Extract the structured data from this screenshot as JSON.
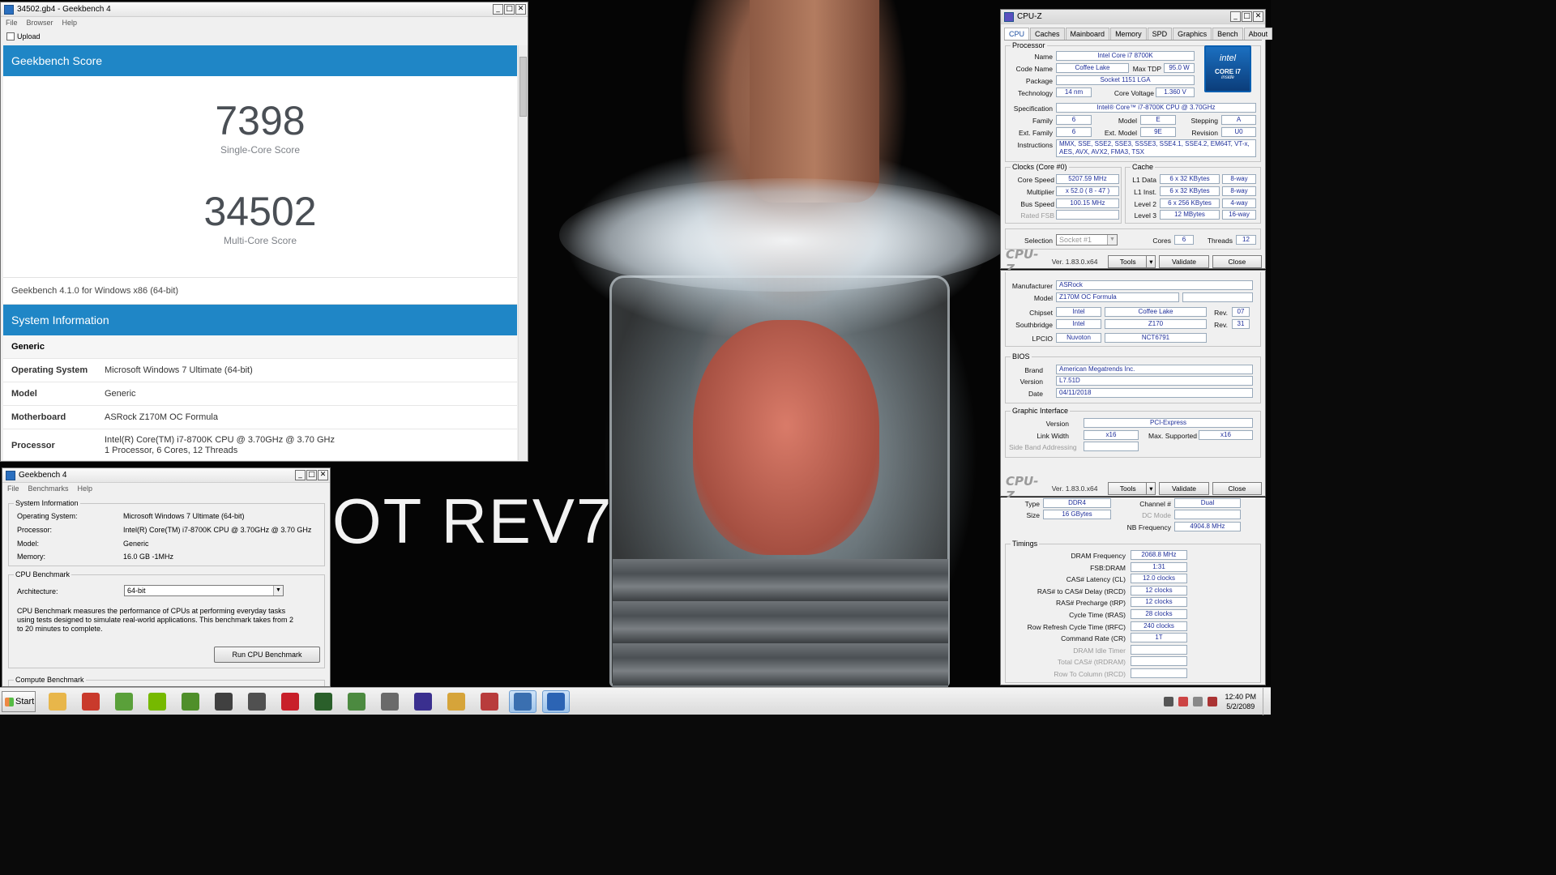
{
  "wallpaper": {
    "overlay_text": "OT REV7"
  },
  "gb_browser": {
    "title": "34502.gb4 - Geekbench 4",
    "menu": [
      "File",
      "Browser",
      "Help"
    ],
    "toolbar_upload": "Upload",
    "score_header": "Geekbench Score",
    "single_core_score": "7398",
    "single_core_label": "Single-Core Score",
    "multi_core_score": "34502",
    "multi_core_label": "Multi-Core Score",
    "version_text": "Geekbench 4.1.0 for Windows x86 (64-bit)",
    "sysinfo_header": "System Information",
    "generic_label": "Generic",
    "rows": [
      {
        "k": "Operating System",
        "v": "Microsoft Windows 7 Ultimate (64-bit)"
      },
      {
        "k": "Model",
        "v": "Generic"
      },
      {
        "k": "Motherboard",
        "v": "ASRock Z170M OC Formula"
      },
      {
        "k": "Processor",
        "v": "Intel(R) Core(TM) i7-8700K CPU @ 3.70GHz @ 3.70 GHz",
        "v2": "1 Processor, 6 Cores, 12 Threads"
      }
    ]
  },
  "gb_launcher": {
    "title": "Geekbench 4",
    "menu": [
      "File",
      "Benchmarks",
      "Help"
    ],
    "sysinfo_title": "System Information",
    "sysinfo": [
      {
        "k": "Operating System:",
        "v": "Microsoft Windows 7 Ultimate (64-bit)"
      },
      {
        "k": "Processor:",
        "v": "Intel(R) Core(TM) i7-8700K CPU @ 3.70GHz @ 3.70 GHz"
      },
      {
        "k": "Model:",
        "v": "Generic"
      },
      {
        "k": "Memory:",
        "v": "16.0 GB  -1MHz"
      }
    ],
    "cpu_bench_title": "CPU Benchmark",
    "arch_label": "Architecture:",
    "arch_value": "64-bit",
    "cpu_bench_desc": "CPU Benchmark measures the performance of CPUs at performing everyday tasks using tests designed to simulate real-world applications. This benchmark takes from 2 to 20 minutes to complete.",
    "run_button": "Run CPU Benchmark",
    "compute_title": "Compute Benchmark"
  },
  "cpuz1": {
    "title": "CPU-Z",
    "tabs": [
      "CPU",
      "Caches",
      "Mainboard",
      "Memory",
      "SPD",
      "Graphics",
      "Bench",
      "About"
    ],
    "processor_group": "Processor",
    "name_lbl": "Name",
    "name": "Intel Core i7 8700K",
    "codename_lbl": "Code Name",
    "codename": "Coffee Lake",
    "maxtdp_lbl": "Max TDP",
    "maxtdp": "95.0 W",
    "package_lbl": "Package",
    "package": "Socket 1151 LGA",
    "technology_lbl": "Technology",
    "technology": "14 nm",
    "corevolt_lbl": "Core Voltage",
    "corevolt": "1.360 V",
    "spec_lbl": "Specification",
    "spec": "Intel® Core™ i7-8700K CPU @ 3.70GHz",
    "family_lbl": "Family",
    "family": "6",
    "model_lbl": "Model",
    "model": "E",
    "stepping_lbl": "Stepping",
    "stepping": "A",
    "extfamily_lbl": "Ext. Family",
    "extfamily": "6",
    "extmodel_lbl": "Ext. Model",
    "extmodel": "9E",
    "revision_lbl": "Revision",
    "revision": "U0",
    "instr_lbl": "Instructions",
    "instr1": "MMX, SSE, SSE2, SSE3, SSSE3, SSE4.1, SSE4.2, EM64T, VT-x,",
    "instr2": "AES, AVX, AVX2, FMA3, TSX",
    "clocks_group": "Clocks (Core #0)",
    "corespeed_lbl": "Core Speed",
    "corespeed": "5207.59 MHz",
    "multiplier_lbl": "Multiplier",
    "multiplier": "x 52.0 ( 8 - 47 )",
    "busspeed_lbl": "Bus Speed",
    "busspeed": "100.15 MHz",
    "ratedfsb_lbl": "Rated FSB",
    "cache_group": "Cache",
    "l1d_lbl": "L1 Data",
    "l1d": "6 x 32 KBytes",
    "l1d_way": "8-way",
    "l1i_lbl": "L1 Inst.",
    "l1i": "6 x 32 KBytes",
    "l1i_way": "8-way",
    "l2_lbl": "Level 2",
    "l2": "6 x 256 KBytes",
    "l2_way": "4-way",
    "l3_lbl": "Level 3",
    "l3": "12 MBytes",
    "l3_way": "16-way",
    "selection_lbl": "Selection",
    "selection": "Socket #1",
    "cores_lbl": "Cores",
    "cores": "6",
    "threads_lbl": "Threads",
    "threads": "12",
    "logo": "CPU-Z",
    "version": "Ver. 1.83.0.x64",
    "tools": "Tools",
    "validate": "Validate",
    "close": "Close",
    "intel_line1": "intel",
    "intel_line2": "CORE i7",
    "intel_line3": "inside"
  },
  "cpuz2": {
    "manufacturer_lbl": "Manufacturer",
    "manufacturer": "ASRock",
    "model_lbl": "Model",
    "model": "Z170M OC Formula",
    "chipset_lbl": "Chipset",
    "chipset_vendor": "Intel",
    "chipset_name": "Coffee Lake",
    "chipset_rev_lbl": "Rev.",
    "chipset_rev": "07",
    "south_lbl": "Southbridge",
    "south_vendor": "Intel",
    "south_name": "Z170",
    "south_rev_lbl": "Rev.",
    "south_rev": "31",
    "lpcio_lbl": "LPCIO",
    "lpcio_vendor": "Nuvoton",
    "lpcio_name": "NCT6791",
    "bios_group": "BIOS",
    "brand_lbl": "Brand",
    "brand": "American Megatrends Inc.",
    "version_lbl": "Version",
    "bios_version": "L7.51D",
    "date_lbl": "Date",
    "date": "04/11/2018",
    "gi_group": "Graphic Interface",
    "gi_version_lbl": "Version",
    "gi_version": "PCI-Express",
    "linkwidth_lbl": "Link Width",
    "linkwidth": "x16",
    "maxsup_lbl": "Max. Supported",
    "maxsup": "x16",
    "sideband_lbl": "Side Band Addressing",
    "logo": "CPU-Z",
    "version": "Ver. 1.83.0.x64",
    "tools": "Tools",
    "validate": "Validate",
    "close": "Close"
  },
  "cpuz3": {
    "type_lbl": "Type",
    "type": "DDR4",
    "channel_lbl": "Channel #",
    "channel": "Dual",
    "size_lbl": "Size",
    "size": "16 GBytes",
    "dcmode_lbl": "DC Mode",
    "nbfreq_lbl": "NB Frequency",
    "nbfreq": "4904.8 MHz",
    "timings_group": "Timings",
    "timings": [
      {
        "k": "DRAM Frequency",
        "v": "2068.8 MHz",
        "gray": false
      },
      {
        "k": "FSB:DRAM",
        "v": "1:31",
        "gray": false
      },
      {
        "k": "CAS# Latency (CL)",
        "v": "12.0 clocks",
        "gray": false
      },
      {
        "k": "RAS# to CAS# Delay (tRCD)",
        "v": "12 clocks",
        "gray": false
      },
      {
        "k": "RAS# Precharge (tRP)",
        "v": "12 clocks",
        "gray": false
      },
      {
        "k": "Cycle Time (tRAS)",
        "v": "28 clocks",
        "gray": false
      },
      {
        "k": "Row Refresh Cycle Time (tRFC)",
        "v": "240 clocks",
        "gray": false
      },
      {
        "k": "Command Rate (CR)",
        "v": "1T",
        "gray": false
      },
      {
        "k": "DRAM Idle Timer",
        "v": "",
        "gray": true
      },
      {
        "k": "Total CAS# (tRDRAM)",
        "v": "",
        "gray": true
      },
      {
        "k": "Row To Column (tRCD)",
        "v": "",
        "gray": true
      }
    ]
  },
  "taskbar": {
    "start": "Start",
    "apps": [
      {
        "name": "explorer-icon",
        "color": "#e8b64a"
      },
      {
        "name": "cpu-tool-icon",
        "color": "#c93a2c"
      },
      {
        "name": "nvidia-tool-icon",
        "color": "#5aa03a"
      },
      {
        "name": "nvidia-icon",
        "color": "#76b900"
      },
      {
        "name": "nvidia-inspector-icon",
        "color": "#4f8f2a"
      },
      {
        "name": "gpu-tweak-icon",
        "color": "#404040"
      },
      {
        "name": "x-tool-icon",
        "color": "#505050"
      },
      {
        "name": "msi-icon",
        "color": "#c8202a"
      },
      {
        "name": "monitor-icon",
        "color": "#2a5f2a"
      },
      {
        "name": "gpuz-icon",
        "color": "#4c8a40"
      },
      {
        "name": "superpi-icon",
        "color": "#6a6a6a"
      },
      {
        "name": "cpuz-icon",
        "color": "#3a2f8f"
      },
      {
        "name": "hwinfo-icon",
        "color": "#d6a43a"
      },
      {
        "name": "stress-icon",
        "color": "#b83c3c"
      },
      {
        "name": "geekbench-icon",
        "color": "#3a6fb0"
      },
      {
        "name": "geekbench2-icon",
        "color": "#2c64b4"
      }
    ],
    "time": "12:40 PM",
    "date": "5/2/2089"
  }
}
